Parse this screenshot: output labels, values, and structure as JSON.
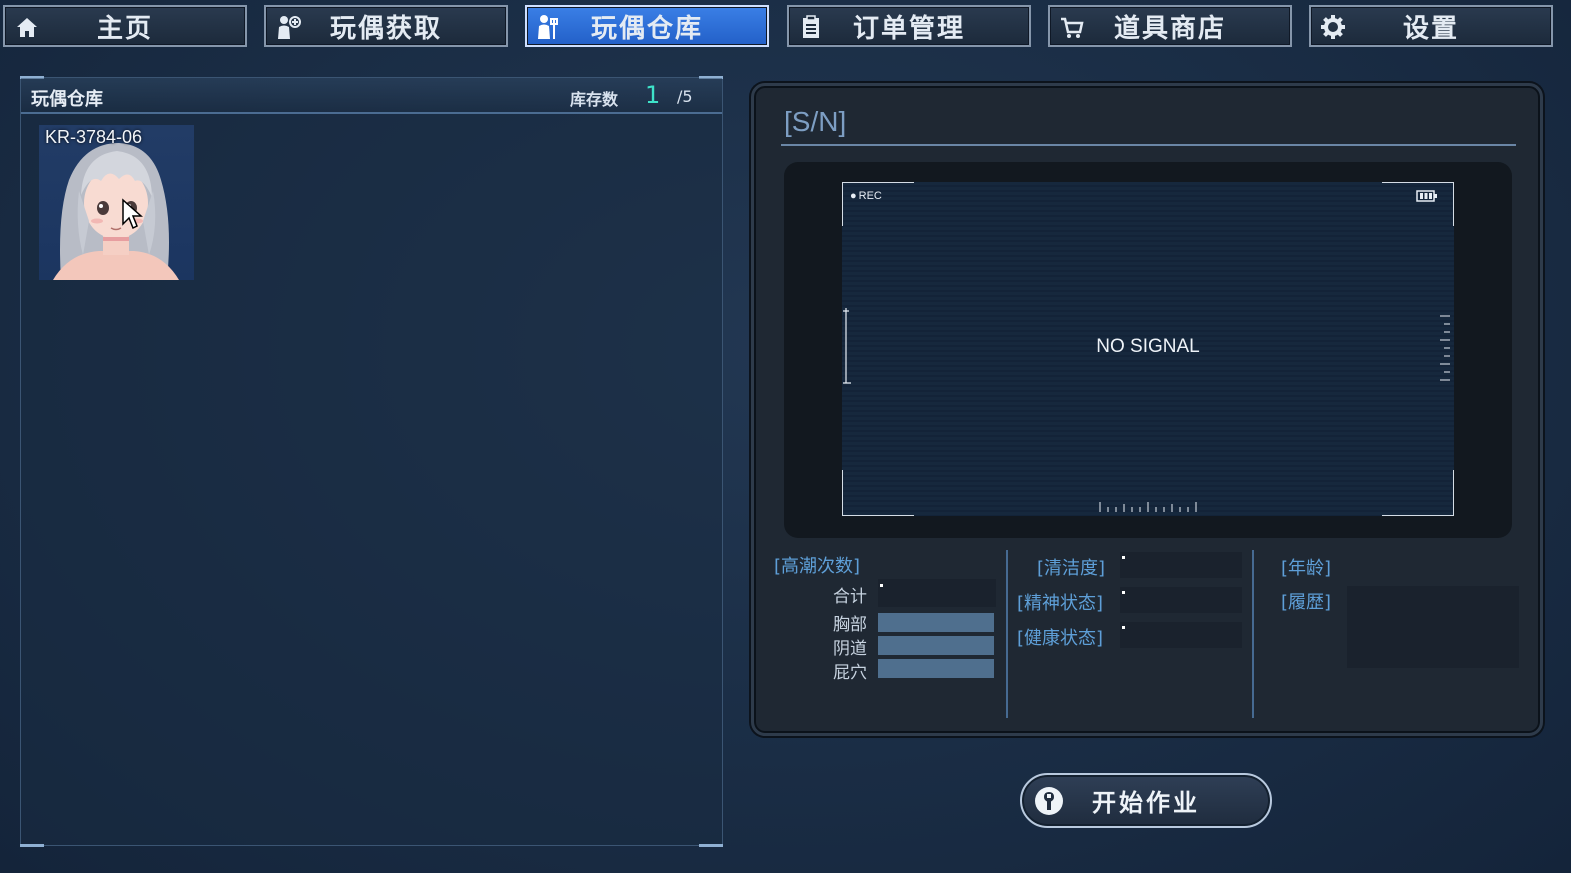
{
  "nav": {
    "items": [
      {
        "label": "主页",
        "icon": "home-icon",
        "active": false
      },
      {
        "label": "玩偶获取",
        "icon": "doll-acquire-icon",
        "active": false
      },
      {
        "label": "玩偶仓库",
        "icon": "doll-warehouse-icon",
        "active": true
      },
      {
        "label": "订单管理",
        "icon": "clipboard-icon",
        "active": false
      },
      {
        "label": "道具商店",
        "icon": "cart-icon",
        "active": false
      },
      {
        "label": "设置",
        "icon": "gear-icon",
        "active": false
      }
    ],
    "active_color": "#2f6fd9"
  },
  "warehouse": {
    "title": "玩偶仓库",
    "stock_label": "库存数",
    "stock_count": "1",
    "stock_max": "/5",
    "dolls": [
      {
        "id": "KR-3784-06"
      }
    ]
  },
  "detail": {
    "sn_label": "[S/N]",
    "monitor": {
      "rec": "REC",
      "status": "NO SIGNAL"
    },
    "orgasm": {
      "title": "[高潮次数]",
      "total_label": "合计",
      "rows": [
        "胸部",
        "阴道",
        "屁穴"
      ]
    },
    "condition": {
      "cleanliness": "[清洁度]",
      "mental": "[精神状态]",
      "health": "[健康状态]"
    },
    "profile": {
      "age": "[年龄]",
      "history": "[履歴]"
    }
  },
  "start_button": {
    "label": "开始作业",
    "icon": "wrench-icon"
  }
}
